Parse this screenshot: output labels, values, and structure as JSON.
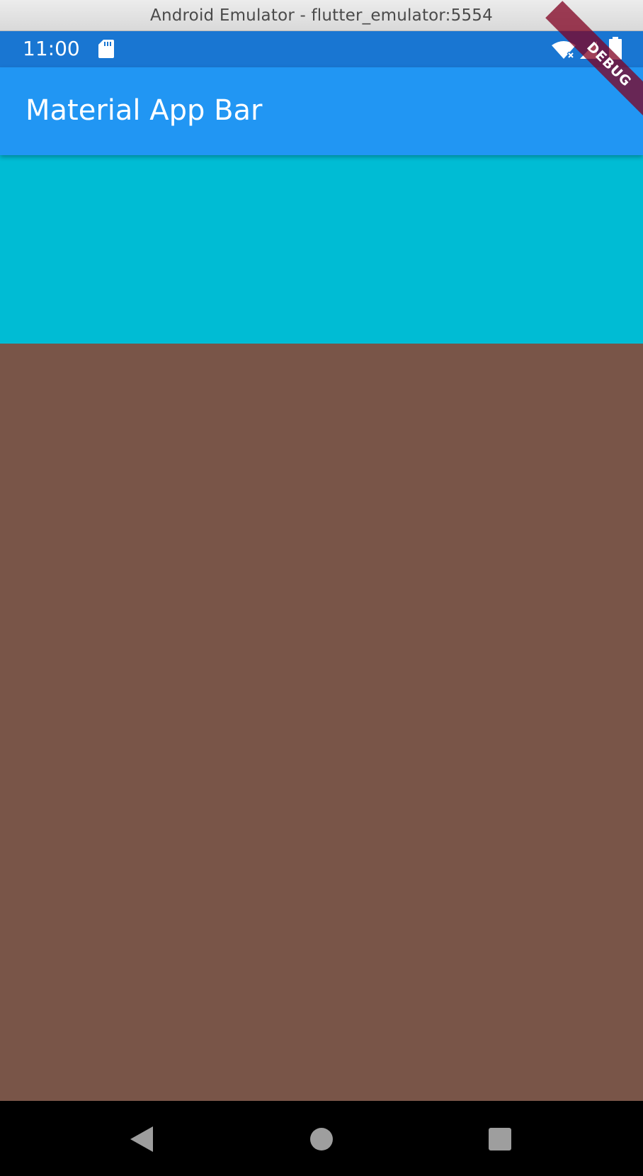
{
  "window": {
    "title": "Android Emulator - flutter_emulator:5554"
  },
  "status_bar": {
    "time": "11:00",
    "icons": [
      "sd-card-icon",
      "wifi-icon",
      "signal-icon",
      "battery-icon"
    ]
  },
  "app_bar": {
    "title": "Material App Bar",
    "color": "#2196f3"
  },
  "debug_banner": {
    "label": "DEBUG"
  },
  "body": {
    "blocks": [
      {
        "name": "cyan-container",
        "color": "#00bcd4"
      },
      {
        "name": "brown-container",
        "color": "#795548"
      }
    ]
  },
  "nav_bar": {
    "buttons": [
      "back-icon",
      "home-icon",
      "recents-icon"
    ]
  },
  "colors": {
    "status_bar": "#1976d2",
    "app_bar": "#2196f3",
    "cyan": "#00bcd4",
    "brown": "#795548",
    "nav_bar": "#000000"
  }
}
